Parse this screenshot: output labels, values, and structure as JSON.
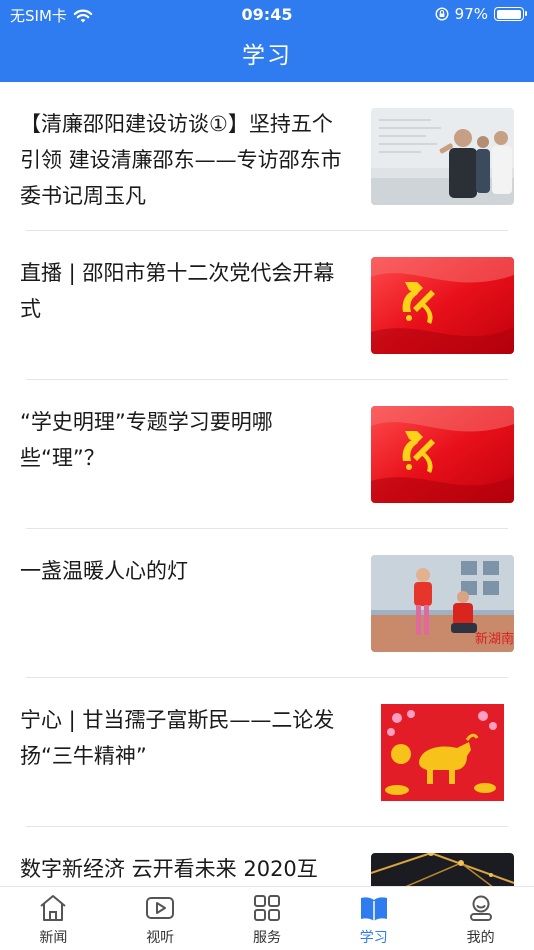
{
  "status_bar": {
    "carrier": "无SIM卡",
    "time": "09:45",
    "battery_percent": "97%",
    "battery_level": 0.97
  },
  "header": {
    "title": "学习"
  },
  "news": [
    {
      "title": "【清廉邵阳建设访谈①】坚持五个引领 建设清廉邵东——专访邵东市委书记周玉凡",
      "thumb": "meeting-photo"
    },
    {
      "title": "直播 | 邵阳市第十二次党代会开幕式",
      "thumb": "party-flag"
    },
    {
      "title": "“学史明理”专题学习要明哪些“理”？",
      "thumb": "party-flag"
    },
    {
      "title": "一盏温暖人心的灯",
      "thumb": "volunteer-photo"
    },
    {
      "title": "宁心 | 甘当孺子富斯民——二论发扬“三牛精神”",
      "thumb": "ox-new-year-poster"
    },
    {
      "title": "数字新经济 云开看未来 2020互",
      "thumb": "digital-economy-photo"
    }
  ],
  "tabs": [
    {
      "label": "新闻",
      "icon": "home-icon",
      "active": false
    },
    {
      "label": "视听",
      "icon": "video-icon",
      "active": false
    },
    {
      "label": "服务",
      "icon": "grid-icon",
      "active": false
    },
    {
      "label": "学习",
      "icon": "book-icon",
      "active": true
    },
    {
      "label": "我的",
      "icon": "profile-icon",
      "active": false
    }
  ],
  "colors": {
    "accent": "#2f7cf0",
    "text": "#1a1a1a",
    "tab_inactive": "#333333",
    "divider": "#e5e5e5"
  }
}
